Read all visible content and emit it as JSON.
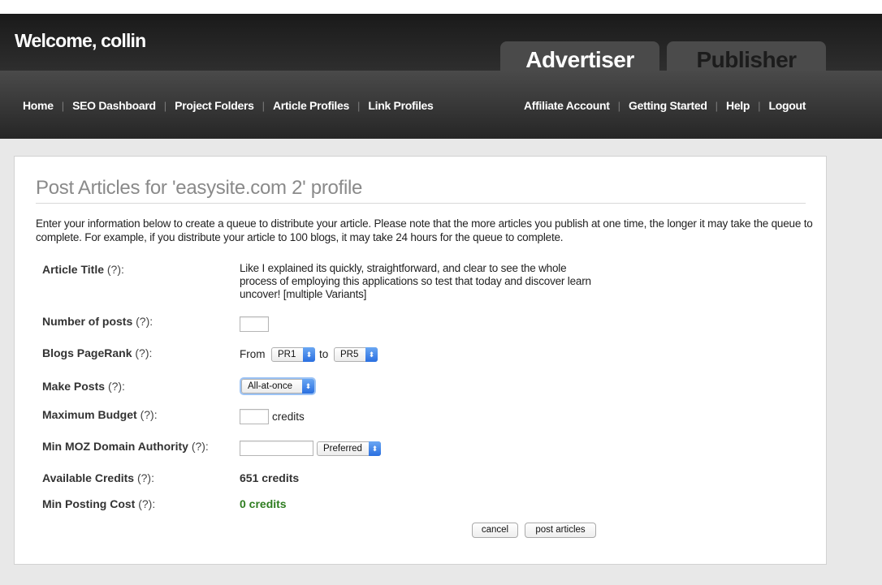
{
  "header": {
    "welcome": "Welcome, collin",
    "tabs": [
      "Advertiser",
      "Publisher"
    ]
  },
  "nav": {
    "left": [
      "Home",
      "SEO Dashboard",
      "Project Folders",
      "Article Profiles",
      "Link Profiles"
    ],
    "right": [
      "Affiliate Account",
      "Getting Started",
      "Help",
      "Logout"
    ],
    "separator": "|"
  },
  "page": {
    "title": "Post Articles for 'easysite.com 2' profile",
    "intro": "Enter your information below to create a queue to distribute your article. Please note that the more articles you publish at one time, the longer it may take the queue to complete. For example, if you distribute your article to 100 blogs, it may take 24 hours for the queue to complete."
  },
  "form": {
    "help_marker": "(?):",
    "article_title": {
      "label": "Article Title",
      "value": "Like I explained its quickly, straightforward, and clear to see the whole process of employing this applications so test that today and discover learn uncover! [multiple Variants]"
    },
    "num_posts": {
      "label": "Number of posts",
      "value": ""
    },
    "pagerank": {
      "label": "Blogs PageRank",
      "from_text": "From",
      "to_text": "to",
      "from_value": "PR1",
      "to_value": "PR5"
    },
    "make_posts": {
      "label": "Make Posts",
      "value": "All-at-once"
    },
    "max_budget": {
      "label": "Maximum Budget",
      "value": "",
      "unit": "credits"
    },
    "min_moz": {
      "label": "Min MOZ Domain Authority",
      "value": "",
      "select_value": "Preferred"
    },
    "available_credits": {
      "label": "Available Credits",
      "value": "651 credits"
    },
    "min_posting_cost": {
      "label": "Min Posting Cost",
      "value": "0 credits"
    }
  },
  "buttons": {
    "cancel": "cancel",
    "post": "post articles"
  },
  "colors": {
    "green_value": "#2e7d20",
    "select_arrow": "#2a6fe0"
  }
}
